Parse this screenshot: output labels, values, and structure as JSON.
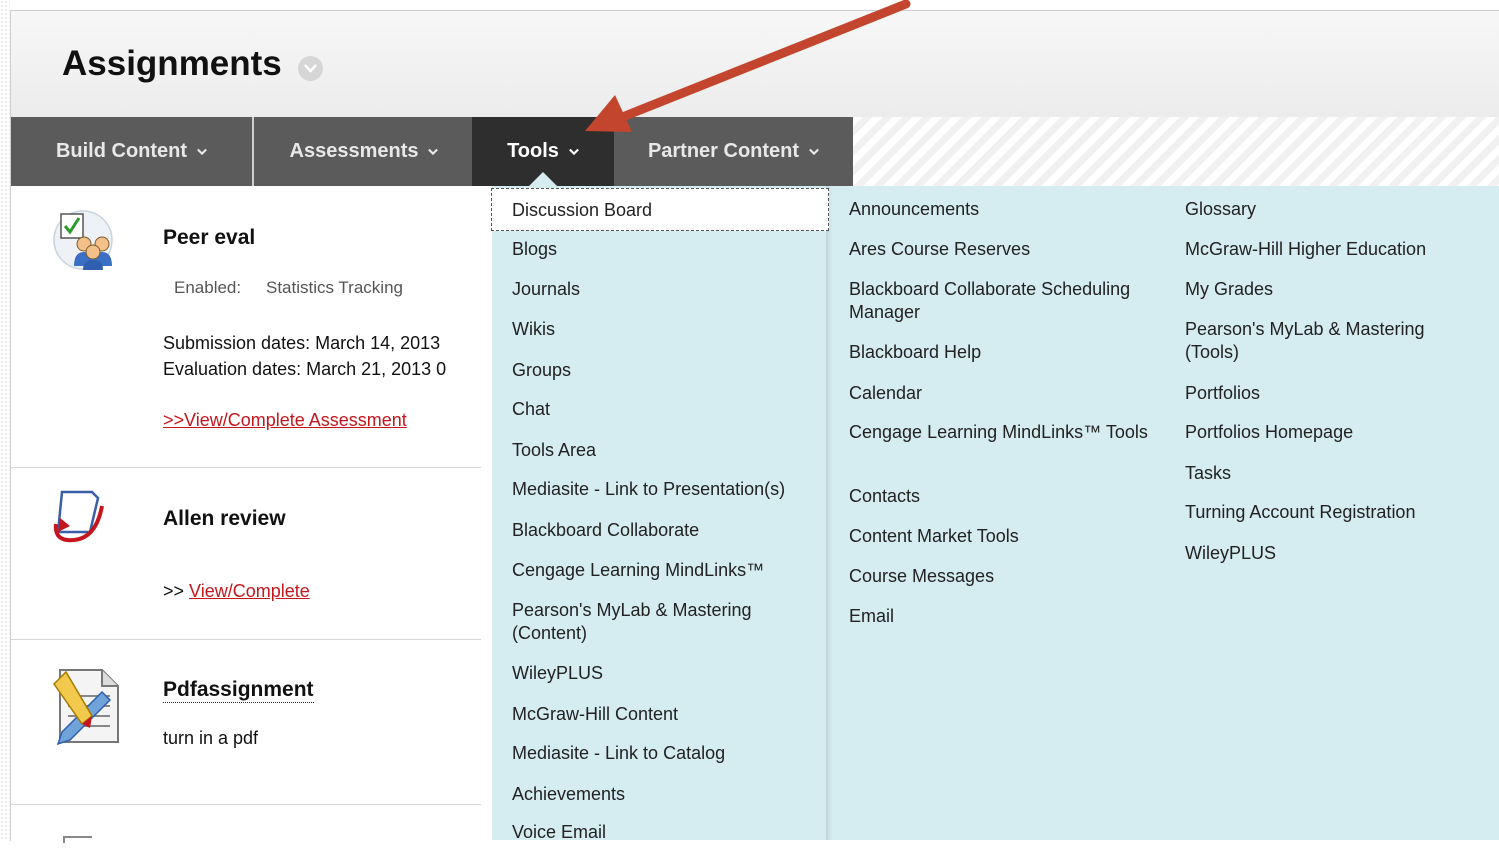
{
  "page": {
    "title": "Assignments"
  },
  "menubar": {
    "items": [
      {
        "label": "Build Content"
      },
      {
        "label": "Assessments"
      },
      {
        "label": "Tools"
      },
      {
        "label": "Partner Content"
      }
    ]
  },
  "content_items": [
    {
      "title": "Peer eval",
      "meta_label": "Enabled:",
      "meta_value": "Statistics Tracking",
      "line1": "Submission dates: March 14, 2013",
      "line2": "Evaluation dates: March 21, 2013 0",
      "link": ">>View/Complete Assessment",
      "icon": "peer-eval-group-icon"
    },
    {
      "title": "Allen review",
      "link_prefix": ">> ",
      "link": "View/Complete",
      "icon": "document-curl-icon"
    },
    {
      "title": "Pdfassignment",
      "description": "turn in a pdf",
      "icon": "assignment-pencil-icon"
    }
  ],
  "tools_menu": {
    "column1": [
      "Discussion Board",
      "Blogs",
      "Journals",
      "Wikis",
      "Groups",
      "Chat",
      "Tools Area",
      "Mediasite - Link to Presentation(s)",
      "Blackboard Collaborate",
      "Cengage Learning MindLinks™",
      "Pearson's MyLab & Mastering (Content)",
      "WileyPLUS",
      "McGraw-Hill Content",
      "Mediasite - Link to Catalog",
      "Achievements",
      "Voice Email"
    ],
    "column2": [
      "Announcements",
      "Ares Course Reserves",
      "Blackboard Collaborate Scheduling Manager",
      "Blackboard Help",
      "Calendar",
      "Cengage Learning MindLinks™ Tools",
      "Contacts",
      "Content Market Tools",
      "Course Messages",
      "Email"
    ],
    "column3": [
      "Glossary",
      "McGraw-Hill Higher Education",
      "My Grades",
      "Pearson's MyLab & Mastering (Tools)",
      "Portfolios",
      "Portfolios Homepage",
      "Tasks",
      "Turning Account Registration",
      "WileyPLUS"
    ]
  },
  "colors": {
    "menubar": "#5b5b5b",
    "menubar_active": "#2e2e2e",
    "dropdown_bg": "#d5ecf1",
    "link_red": "#c4161c",
    "annotation_arrow": "#c4452e"
  }
}
